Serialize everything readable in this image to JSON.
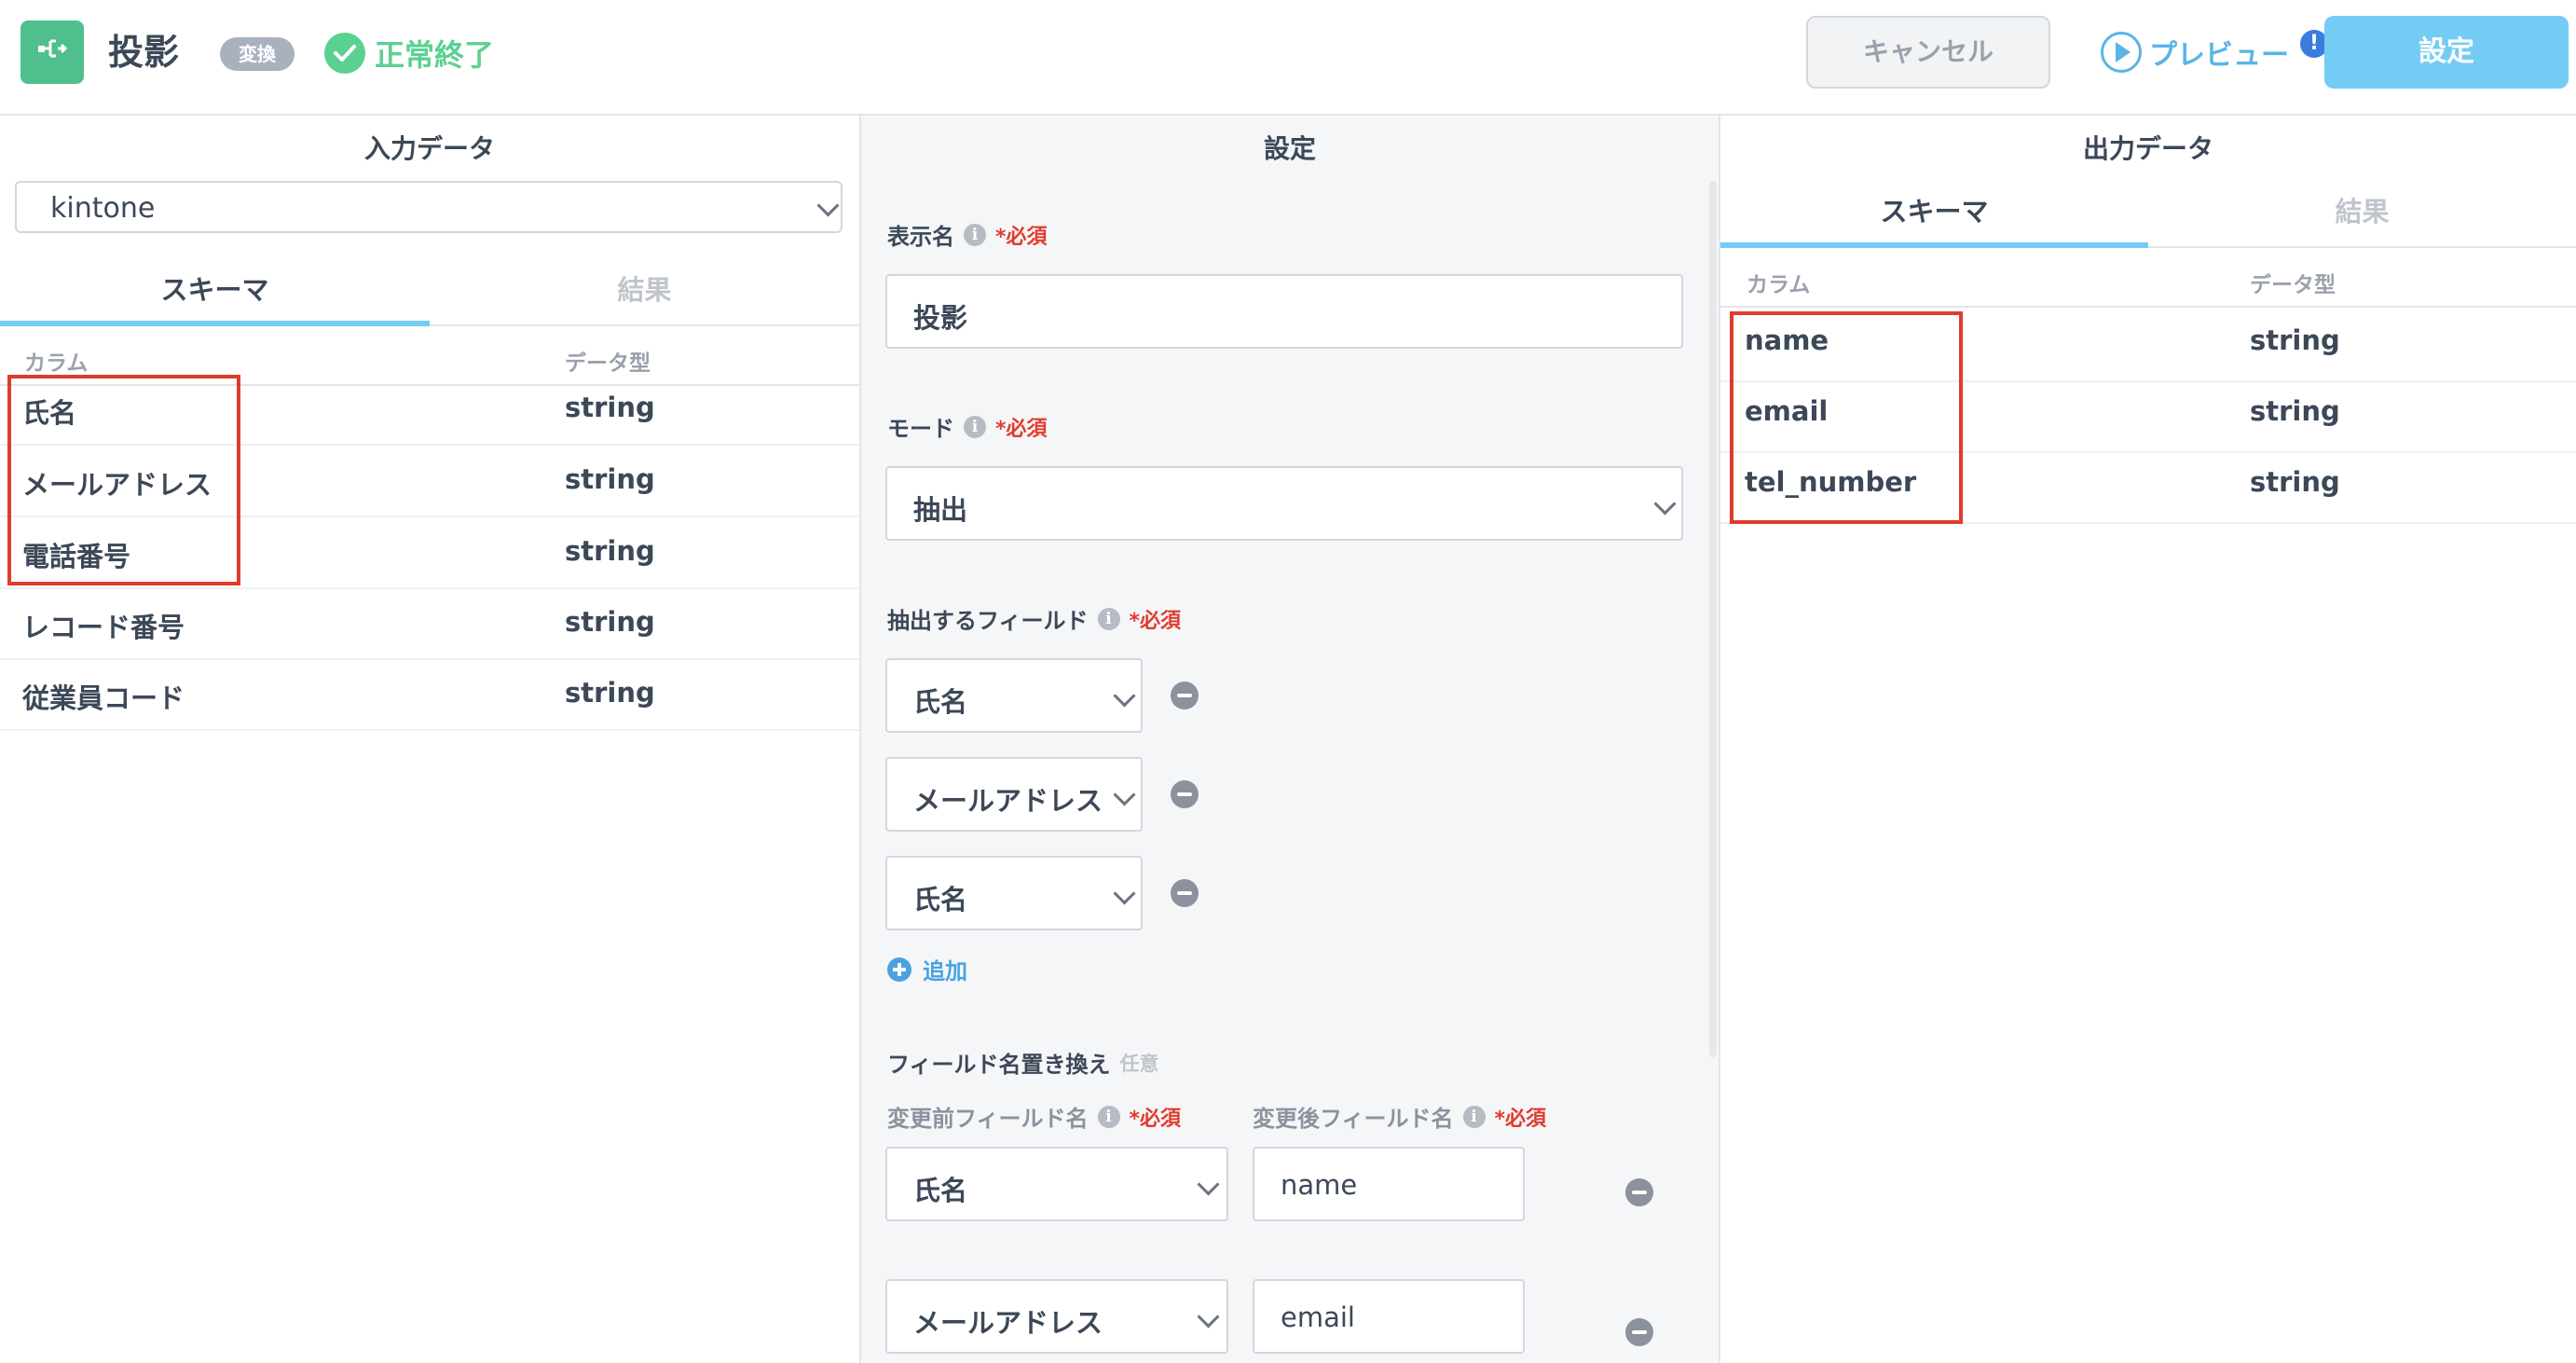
{
  "header": {
    "title": "投影",
    "tag": "変換",
    "status": "正常終了",
    "cancel_label": "キャンセル",
    "preview_label": "プレビュー",
    "preview_badge": "!",
    "submit_label": "設定"
  },
  "input_pane": {
    "title": "入力データ",
    "source_value": "kintone",
    "tabs": [
      "スキーマ",
      "結果"
    ],
    "active_tab": "スキーマ",
    "col_headers": [
      "カラム",
      "データ型"
    ],
    "rows": [
      {
        "column": "氏名",
        "type": "string"
      },
      {
        "column": "メールアドレス",
        "type": "string"
      },
      {
        "column": "電話番号",
        "type": "string"
      },
      {
        "column": "レコード番号",
        "type": "string"
      },
      {
        "column": "従業員コード",
        "type": "string"
      }
    ]
  },
  "settings_pane": {
    "title": "設定",
    "display_name": {
      "label": "表示名",
      "required": "*必須",
      "value": "投影"
    },
    "mode": {
      "label": "モード",
      "required": "*必須",
      "value": "抽出"
    },
    "extract_fields": {
      "label": "抽出するフィールド",
      "required": "*必須",
      "items": [
        "氏名",
        "メールアドレス",
        "氏名"
      ],
      "add_label": "追加"
    },
    "rename": {
      "label": "フィールド名置き換え",
      "optional": "任意",
      "before_label": "変更前フィールド名",
      "after_label": "変更後フィールド名",
      "required": "*必須",
      "rows": [
        {
          "before": "氏名",
          "after": "name"
        },
        {
          "before": "メールアドレス",
          "after": "email"
        }
      ]
    }
  },
  "output_pane": {
    "title": "出力データ",
    "tabs": [
      "スキーマ",
      "結果"
    ],
    "active_tab": "スキーマ",
    "col_headers": [
      "カラム",
      "データ型"
    ],
    "rows": [
      {
        "column": "name",
        "type": "string"
      },
      {
        "column": "email",
        "type": "string"
      },
      {
        "column": "tel_number",
        "type": "string"
      }
    ]
  },
  "colors": {
    "accent": "#74ccf4",
    "success": "#5bd191",
    "required": "#e03c2d",
    "highlight_box": "#e03c2d",
    "link": "#4aa3df"
  }
}
